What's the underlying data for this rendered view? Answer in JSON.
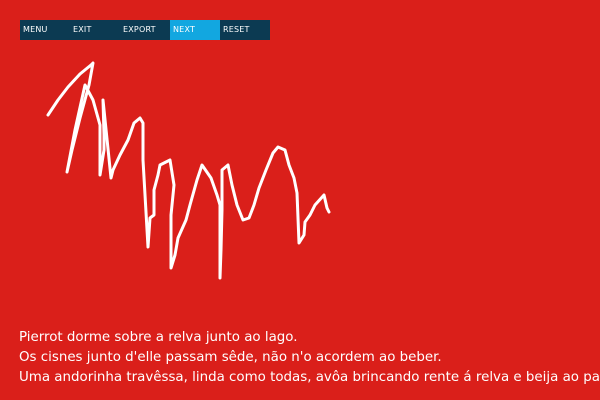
{
  "menu": {
    "items": [
      {
        "label": "MENU"
      },
      {
        "label": "EXIT"
      },
      {
        "label": "EXPORT"
      },
      {
        "label": "NEXT"
      },
      {
        "label": "RESET"
      }
    ],
    "active_index": 3
  },
  "colors": {
    "background": "#da1f1a",
    "menu_bar": "#0c3a52",
    "menu_active": "#12a7e0",
    "text": "#ffffff",
    "stroke": "#ffffff"
  },
  "poem": {
    "lines": [
      "Pierrot dorme sobre a relva junto ao lago.",
      "Os cisnes junto d'elle passam sêde, não n'o acordem ao beber.",
      "Uma andorinha travêssa, linda como todas, avôa brincando rente á relva e beija ao passar"
    ]
  }
}
